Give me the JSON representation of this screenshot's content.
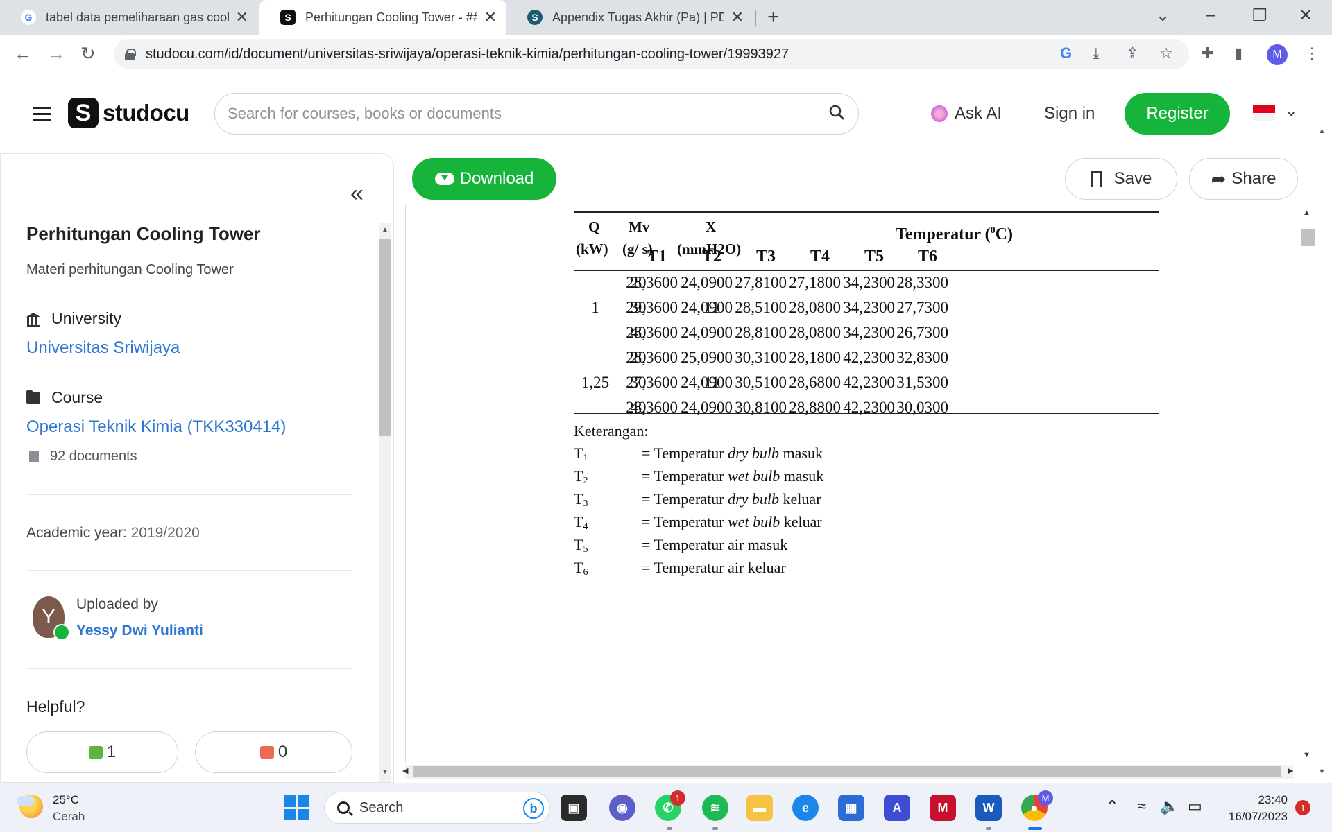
{
  "browser": {
    "tabs": [
      {
        "title": "tabel data pemeliharaan gas cool",
        "favicon": "G",
        "active": false
      },
      {
        "title": "Perhitungan Cooling Tower - ###",
        "favicon": "S",
        "active": true
      },
      {
        "title": "Appendix Tugas Akhir (Pa) | PDF",
        "favicon": "S",
        "active": false
      }
    ],
    "url": "studocu.com/id/document/universitas-sriwijaya/operasi-teknik-kimia/perhitungan-cooling-tower/19993927",
    "profile_initial": "M"
  },
  "header": {
    "logo_text": "studocu",
    "search_placeholder": "Search for courses, books or documents",
    "ask_ai": "Ask AI",
    "sign_in": "Sign in",
    "register": "Register"
  },
  "sidebar": {
    "title": "Perhitungan Cooling Tower",
    "subtitle": "Materi perhitungan Cooling Tower",
    "university_label": "University",
    "university": "Universitas Sriwijaya",
    "course_label": "Course",
    "course": "Operasi Teknik Kimia (TKK330414)",
    "documents": "92 documents",
    "academic_year_label": "Academic year:",
    "academic_year": "2019/2020",
    "uploaded_by_label": "Uploaded by",
    "uploader": "Yessy Dwi Yulianti",
    "avatar_initial": "Y",
    "helpful_label": "Helpful?",
    "upvotes": "1",
    "downvotes": "0"
  },
  "viewer": {
    "download": "Download",
    "save": "Save",
    "share": "Share"
  },
  "document": {
    "headers": {
      "q": "Q",
      "q_unit": "(kW)",
      "mv": "Mv",
      "mv_unit": "(g/ s)",
      "x": "X",
      "x_unit": "(mmH2O)",
      "temp_prefix": "Temperatur (",
      "temp_sup": "0",
      "temp_suffix": "C)",
      "t_cols": [
        "T1",
        "T2",
        "T3",
        "T4",
        "T5",
        "T6"
      ]
    },
    "groups": [
      {
        "q": "1",
        "x": "11",
        "rows": [
          {
            "mv": "20",
            "t": [
              "28,3600",
              "24,0900",
              "27,8100",
              "27,1800",
              "34,2300",
              "28,3300"
            ]
          },
          {
            "mv": "30",
            "t": [
              "29,3600",
              "24,0900",
              "28,5100",
              "28,0800",
              "34,2300",
              "27,7300"
            ]
          },
          {
            "mv": "40",
            "t": [
              "28,3600",
              "24,0900",
              "28,8100",
              "28,0800",
              "34,2300",
              "26,7300"
            ]
          }
        ]
      },
      {
        "q": "1,25",
        "x": "11",
        "rows": [
          {
            "mv": "20",
            "t": [
              "28,3600",
              "25,0900",
              "30,3100",
              "28,1800",
              "42,2300",
              "32,8300"
            ]
          },
          {
            "mv": "30",
            "t": [
              "27,3600",
              "24,0900",
              "30,5100",
              "28,6800",
              "42,2300",
              "31,5300"
            ]
          },
          {
            "mv": "40",
            "t": [
              "28,3600",
              "24,0900",
              "30,8100",
              "28,8800",
              "42,2300",
              "30,0300"
            ]
          }
        ]
      }
    ],
    "keterangan_title": "Keterangan:",
    "notes": [
      {
        "sym": "T",
        "sub": "1",
        "pre": "= Temperatur ",
        "em": "dry bulb",
        "post": " masuk"
      },
      {
        "sym": "T",
        "sub": "2",
        "pre": "= Temperatur ",
        "em": "wet bulb",
        "post": " masuk"
      },
      {
        "sym": "T",
        "sub": "3",
        "pre": "= Temperatur ",
        "em": "dry bulb",
        "post": " keluar"
      },
      {
        "sym": "T",
        "sub": "4",
        "pre": "= Temperatur ",
        "em": "wet bulb",
        "post": " keluar"
      },
      {
        "sym": "T",
        "sub": "5",
        "pre": "= Temperatur air masuk",
        "em": "",
        "post": ""
      },
      {
        "sym": "T",
        "sub": "6",
        "pre": "= Temperatur air keluar",
        "em": "",
        "post": ""
      }
    ]
  },
  "taskbar": {
    "temperature": "25°C",
    "condition": "Cerah",
    "search": "Search",
    "time": "23:40",
    "date": "16/07/2023",
    "whatsapp_badge": "1",
    "notification_badge": "1",
    "chrome_profile": "M"
  }
}
